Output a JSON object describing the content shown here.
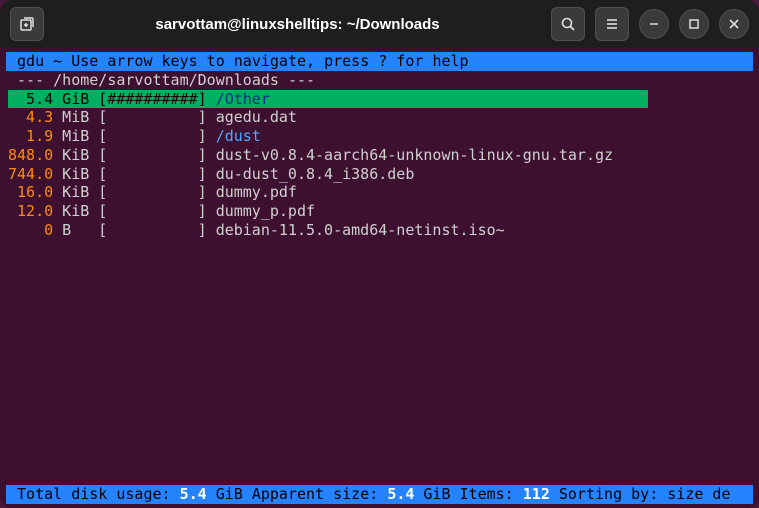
{
  "window": {
    "title": "sarvottam@linuxshelltips: ~/Downloads"
  },
  "gdu": {
    "header": " gdu ~ Use arrow keys to navigate, press ? for help",
    "path_line": " --- /home/sarvottam/Downloads ---",
    "rows": [
      {
        "size": "5.4",
        "unit": "GiB",
        "bar": "[##########]",
        "name": "/Other",
        "is_dir": true,
        "selected": true
      },
      {
        "size": "4.3",
        "unit": "MiB",
        "bar": "[          ]",
        "name": "agedu.dat",
        "is_dir": false,
        "selected": false
      },
      {
        "size": "1.9",
        "unit": "MiB",
        "bar": "[          ]",
        "name": "/dust",
        "is_dir": true,
        "selected": false
      },
      {
        "size": "848.0",
        "unit": "KiB",
        "bar": "[          ]",
        "name": "dust-v0.8.4-aarch64-unknown-linux-gnu.tar.gz",
        "is_dir": false,
        "selected": false
      },
      {
        "size": "744.0",
        "unit": "KiB",
        "bar": "[          ]",
        "name": "du-dust_0.8.4_i386.deb",
        "is_dir": false,
        "selected": false
      },
      {
        "size": "16.0",
        "unit": "KiB",
        "bar": "[          ]",
        "name": "dummy.pdf",
        "is_dir": false,
        "selected": false
      },
      {
        "size": "12.0",
        "unit": "KiB",
        "bar": "[          ]",
        "name": "dummy_p.pdf",
        "is_dir": false,
        "selected": false
      },
      {
        "size": "0",
        "unit": "B  ",
        "bar": "[          ]",
        "name": "debian-11.5.0-amd64-netinst.iso~",
        "is_dir": false,
        "selected": false
      }
    ],
    "footer": {
      "label_total": " Total disk usage: ",
      "total_value": "5.4",
      "label_apparent": " GiB Apparent size: ",
      "apparent_value": "5.4",
      "label_items": " GiB Items: ",
      "items_value": "112",
      "label_sort": " Sorting by: size de"
    }
  }
}
